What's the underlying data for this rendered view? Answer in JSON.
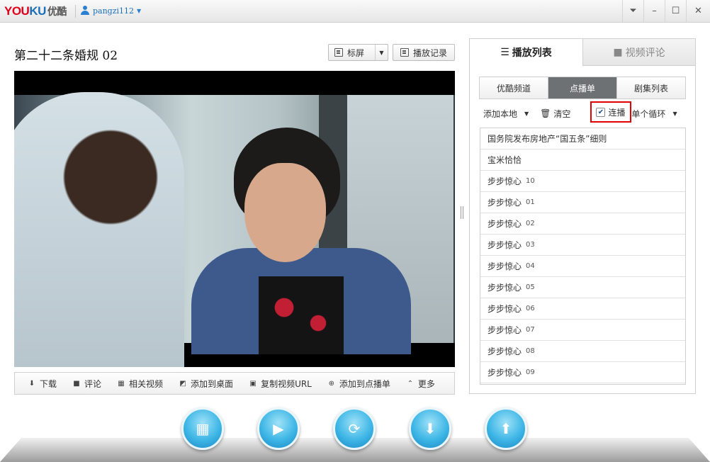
{
  "titlebar": {
    "logo_you": "YOU",
    "logo_ku": "KU",
    "logo_cn": "优酷",
    "username": "pangzi112"
  },
  "header": {
    "video_title": "第二十二条婚规 02",
    "screen_label": "标屏",
    "history_label": "播放记录"
  },
  "actions": [
    {
      "label": "下载",
      "icon": "download-icon"
    },
    {
      "label": "评论",
      "icon": "comment-icon"
    },
    {
      "label": "相关视频",
      "icon": "film-icon"
    },
    {
      "label": "添加到桌面",
      "icon": "desktop-icon"
    },
    {
      "label": "复制视频URL",
      "icon": "copy-icon"
    },
    {
      "label": "添加到点播单",
      "icon": "add-list-icon"
    },
    {
      "label": "更多",
      "icon": "more-icon"
    }
  ],
  "panel": {
    "tabs": [
      {
        "label": "播放列表",
        "icon": "list-icon",
        "active": true
      },
      {
        "label": "视频评论",
        "icon": "comment-icon",
        "active": false
      }
    ],
    "subtabs": [
      {
        "label": "优酷频道",
        "active": false
      },
      {
        "label": "点播单",
        "active": true
      },
      {
        "label": "剧集列表",
        "active": false
      }
    ],
    "toolbar": {
      "add_local": "添加本地",
      "clear": "清空",
      "lianbo": "连播",
      "lianbo_checked": true,
      "loop_mode": "单个循环"
    },
    "playlist": [
      {
        "title": "国务院发布房地产“国五条”细则",
        "num": ""
      },
      {
        "title": "宝米恰恰",
        "num": ""
      },
      {
        "title": "步步惊心",
        "num": "10"
      },
      {
        "title": "步步惊心",
        "num": "01"
      },
      {
        "title": "步步惊心",
        "num": "02"
      },
      {
        "title": "步步惊心",
        "num": "03"
      },
      {
        "title": "步步惊心",
        "num": "04"
      },
      {
        "title": "步步惊心",
        "num": "05"
      },
      {
        "title": "步步惊心",
        "num": "06"
      },
      {
        "title": "步步惊心",
        "num": "07"
      },
      {
        "title": "步步惊心",
        "num": "08"
      },
      {
        "title": "步步惊心",
        "num": "09"
      }
    ]
  },
  "dock": [
    {
      "name": "video-library-icon",
      "glyph": "▦"
    },
    {
      "name": "playlist-icon",
      "glyph": "▶"
    },
    {
      "name": "convert-icon",
      "glyph": "⟳"
    },
    {
      "name": "download-icon",
      "glyph": "⬇"
    },
    {
      "name": "upload-icon",
      "glyph": "⬆"
    }
  ],
  "colors": {
    "accent_blue": "#1a86c4",
    "highlight_red": "#e00000",
    "active_subtab": "#6e7174"
  }
}
